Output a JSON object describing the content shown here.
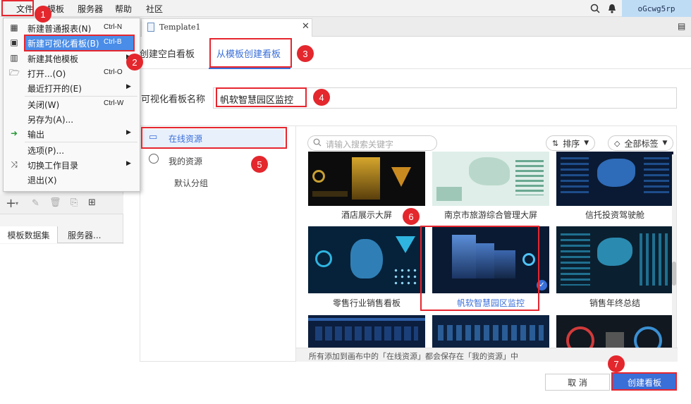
{
  "menubar": {
    "items": [
      "文件",
      "模板",
      "服务器",
      "帮助",
      "社区"
    ],
    "user": "oGcwg5rp"
  },
  "file_menu": {
    "items": [
      {
        "label": "新建普通报表(N)",
        "shortcut": "Ctrl-N",
        "icon": "grid-icon"
      },
      {
        "label": "新建可视化看板(B)",
        "shortcut": "Ctrl-B",
        "icon": "dashboard-icon"
      },
      {
        "label": "新建其他模板",
        "shortcut": "",
        "icon": "table-icon"
      },
      {
        "label": "打开...(O)",
        "shortcut": "Ctrl-O",
        "icon": "folder-open-icon"
      },
      {
        "label": "最近打开的(E)",
        "shortcut": "",
        "icon": ""
      },
      {
        "label": "关闭(W)",
        "shortcut": "Ctrl-W",
        "icon": ""
      },
      {
        "label": "另存为(A)...",
        "shortcut": "",
        "icon": ""
      },
      {
        "label": "输出",
        "shortcut": "",
        "icon": "export-icon"
      },
      {
        "label": "选项(P)...",
        "shortcut": "",
        "icon": ""
      },
      {
        "label": "切换工作目录",
        "shortcut": "",
        "icon": "shuffle-icon"
      },
      {
        "label": "退出(X)",
        "shortcut": "",
        "icon": ""
      }
    ]
  },
  "document_tab": {
    "label": "Template1"
  },
  "left_panel": {
    "tabs": [
      "模板数据集",
      "服务器..."
    ]
  },
  "dialog": {
    "tabs": [
      "创建空白看板",
      "从模板创建看板"
    ],
    "name_label": "可视化看板名称",
    "name_value": "帆软智慧园区监控",
    "sidebar": {
      "online": "在线资源",
      "mine": "我的资源",
      "default_group": "默认分组"
    },
    "search_placeholder": "请输入搜索关键字",
    "sort_label": "排序",
    "tags_label": "全部标签",
    "templates": [
      {
        "caption": "酒店展示大屏",
        "selected": false
      },
      {
        "caption": "南京市旅游综合管理大屏",
        "selected": false
      },
      {
        "caption": "信托投资驾驶舱",
        "selected": false
      },
      {
        "caption": "零售行业销售看板",
        "selected": false
      },
      {
        "caption": "帆软智慧园区监控",
        "selected": true
      },
      {
        "caption": "销售年终总结",
        "selected": false
      }
    ],
    "footer_note": "所有添加到画布中的「在线资源」都会保存在「我的资源」中",
    "cancel_label": "取 消",
    "create_label": "创建看板"
  },
  "badges": [
    "1",
    "2",
    "3",
    "4",
    "5",
    "6",
    "7"
  ],
  "colors": {
    "accent": "#3a6fd8",
    "red": "#e6262f",
    "highlight": "#4a8de8"
  }
}
